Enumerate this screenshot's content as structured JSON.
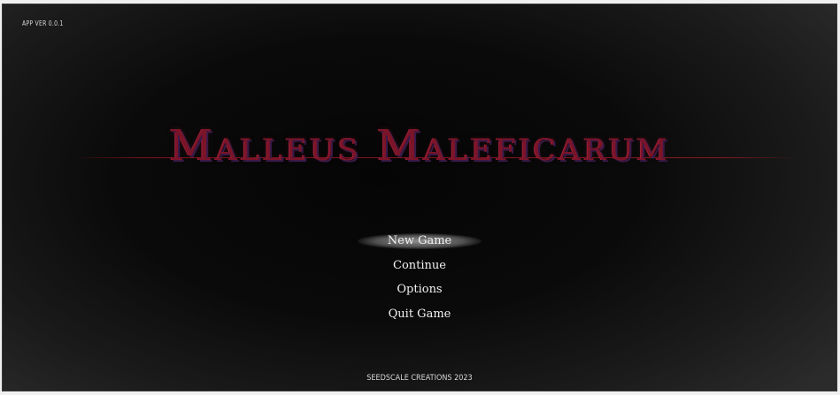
{
  "app_version": "APP VER 0.0.1",
  "title": "Malleus Maleficarum",
  "menu": {
    "items": [
      {
        "label": "New Game"
      },
      {
        "label": "Continue"
      },
      {
        "label": "Options"
      },
      {
        "label": "Quit Game"
      }
    ],
    "selected_index": 0
  },
  "footer": "SEEDSCALE CREATIONS 2023",
  "colors": {
    "title": "#7a1428",
    "title_shadow": "#3a1a4a",
    "background": "#0a0a0a",
    "menu_text": "#f2f2f2"
  }
}
